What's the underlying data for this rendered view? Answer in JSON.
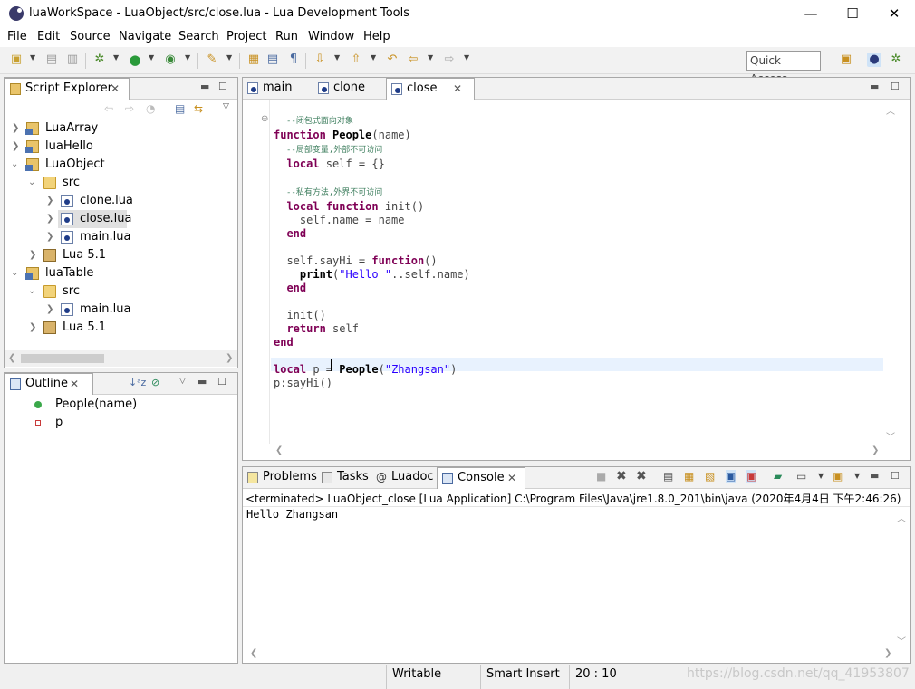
{
  "window": {
    "title": "luaWorkSpace - LuaObject/src/close.lua - Lua Development Tools",
    "minimize": "—",
    "maximize": "☐",
    "close": "✕"
  },
  "menu": [
    "File",
    "Edit",
    "Source",
    "Navigate",
    "Search",
    "Project",
    "Run",
    "Window",
    "Help"
  ],
  "toolbar": {
    "quick_access": "Quick Access"
  },
  "script_explorer": {
    "tab_label": "Script Explorer",
    "items": [
      {
        "label": "LuaArray"
      },
      {
        "label": "luaHello"
      },
      {
        "label": "LuaObject"
      },
      {
        "label": "src"
      },
      {
        "label": "clone.lua"
      },
      {
        "label": "close.lua"
      },
      {
        "label": "main.lua"
      },
      {
        "label": "Lua 5.1"
      },
      {
        "label": "luaTable"
      },
      {
        "label": "src"
      },
      {
        "label": "main.lua"
      },
      {
        "label": "Lua 5.1"
      }
    ]
  },
  "outline": {
    "tab_label": "Outline",
    "items": [
      "People(name)",
      "p"
    ]
  },
  "editor": {
    "tabs": [
      "main",
      "clone",
      "close"
    ],
    "active_tab": "close",
    "lines": {
      "l1": "--闭包式面向对象",
      "l2a": "function",
      "l2b": "People",
      "l2c": "(name)",
      "l3": "--局部变量,外部不可访问",
      "l4a": "local",
      "l4b": " self = {}",
      "l6": "--私有方法,外界不可访问",
      "l7a": "local",
      "l7b": "function",
      "l7c": " init()",
      "l8": "self.name = name",
      "l9": "end",
      "l11a": "self.sayHi = ",
      "l11b": "function",
      "l11c": "()",
      "l12a": "print",
      "l12b": "(",
      "l12c": "\"Hello \"",
      "l12d": "..self.name)",
      "l13": "end",
      "l15": "init()",
      "l16a": "return",
      "l16b": " self",
      "l17": "end",
      "l19a": "local",
      "l19b": " p = ",
      "l19c": "People",
      "l19d": "(",
      "l19e": "\"Zhangsan\"",
      "l19f": ")",
      "l20": "p:sayHi()"
    }
  },
  "bottom_panel": {
    "tabs": [
      "Problems",
      "Tasks",
      "Luadoc",
      "Console"
    ],
    "active_tab": "Console",
    "header": "<terminated> LuaObject_close [Lua Application] C:\\Program Files\\Java\\jre1.8.0_201\\bin\\java (2020年4月4日 下午2:46:26)",
    "output": "Hello Zhangsan"
  },
  "status": {
    "writable": "Writable",
    "insert_mode": "Smart Insert",
    "position": "20 : 10"
  },
  "watermark": "https://blog.csdn.net/qq_41953807"
}
